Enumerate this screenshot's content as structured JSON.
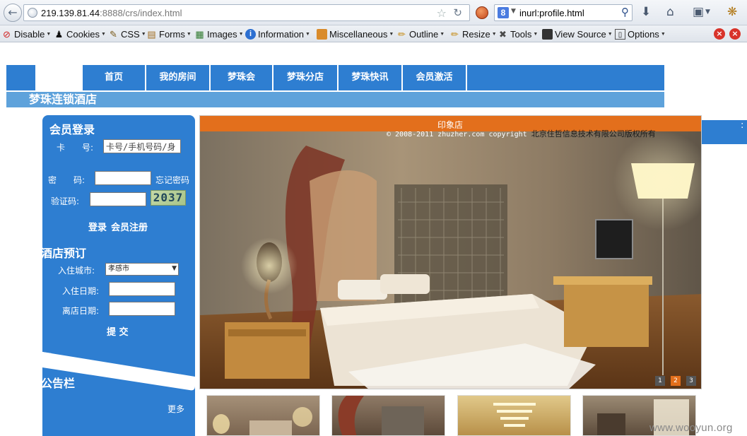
{
  "browser": {
    "url_host": "219.139.81.44",
    "url_rest": ":8888/crs/index.html",
    "search_engine": "8",
    "search_query": "inurl:profile.html"
  },
  "devbar": {
    "items": [
      "Disable",
      "Cookies",
      "CSS",
      "Forms",
      "Images",
      "Information",
      "Miscellaneous",
      "Outline",
      "Resize",
      "Tools",
      "View Source",
      "Options"
    ]
  },
  "nav": {
    "items": [
      "首页",
      "我的房间",
      "梦珠会",
      "梦珠分店",
      "梦珠快讯",
      "会员激活"
    ]
  },
  "hotel_name": "梦珠连锁酒店",
  "login": {
    "title": "会员登录",
    "card_label": "卡　　号:",
    "card_placeholder": "卡号/手机号码/身",
    "password_label": "密　　码:",
    "forgot_link": "忘记密码",
    "captcha_label": "验证码:",
    "captcha_value": "2037",
    "login_link": "登录",
    "register_link": "会员注册"
  },
  "booking": {
    "title": "酒店预订",
    "city_label": "入住城市:",
    "city_value": "孝感市",
    "checkin_label": "入住日期:",
    "checkout_label": "离店日期:",
    "submit_label": "提 交"
  },
  "notice": {
    "title": "公告栏",
    "more_link": "更多"
  },
  "banner": {
    "title": "印象店",
    "copyright_en": "© 2008-2011 zhuzher.com copyright",
    "copyright_cn": "北京住哲信息技术有限公司版权所有",
    "pages": [
      "1",
      "2",
      "3"
    ],
    "active_page": 2
  },
  "watermark": "www.wooyun.org",
  "colors": {
    "primary_blue": "#2e7ed1",
    "light_blue": "#5ea2db",
    "banner_orange": "#e36f1c"
  }
}
